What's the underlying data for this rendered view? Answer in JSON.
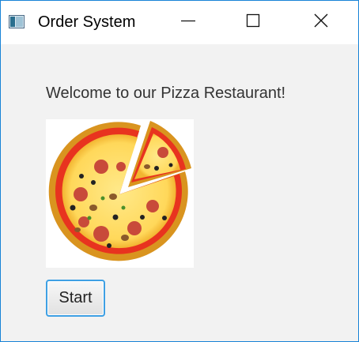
{
  "window": {
    "title": "Order System",
    "app_icon": "java-window-icon",
    "controls": {
      "minimize": "minimize-icon",
      "maximize": "maximize-icon",
      "close": "close-icon"
    }
  },
  "main": {
    "welcome_text": "Welcome to our Pizza Restaurant!",
    "image": "pizza-image",
    "start_button": "Start"
  },
  "colors": {
    "window_border": "#1883d7",
    "button_focus_border": "#3ea0e4",
    "background": "#f2f2f2"
  }
}
